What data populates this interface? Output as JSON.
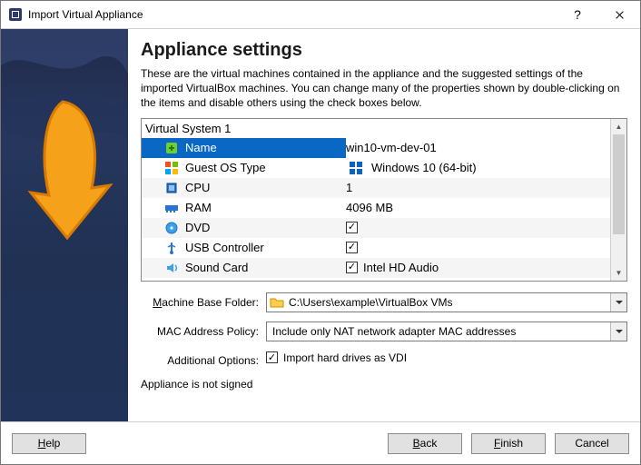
{
  "window": {
    "title": "Import Virtual Appliance"
  },
  "heading": "Appliance settings",
  "intro": "These are the virtual machines contained in the appliance and the suggested settings of the imported VirtualBox machines. You can change many of the properties shown by double-clicking on the items and disable others using the check boxes below.",
  "table": {
    "system_label": "Virtual System 1",
    "rows": {
      "name": {
        "label": "Name",
        "value": "win10-vm-dev-01"
      },
      "os": {
        "label": "Guest OS Type",
        "value": "Windows 10 (64-bit)"
      },
      "cpu": {
        "label": "CPU",
        "value": "1"
      },
      "ram": {
        "label": "RAM",
        "value": "4096 MB"
      },
      "dvd": {
        "label": "DVD",
        "checked": true
      },
      "usb": {
        "label": "USB Controller",
        "checked": true
      },
      "sound": {
        "label": "Sound Card",
        "checked": true,
        "value": "Intel HD Audio"
      }
    }
  },
  "form": {
    "base_folder_label": "achine Base Folder:",
    "base_folder_prefix": "M",
    "base_folder_value": "C:\\Users\\example\\VirtualBox VMs",
    "mac_label": "MAC Address Policy:",
    "mac_value": "Include only NAT network adapter MAC addresses",
    "options_label": "Additional Options:",
    "vdi_label": "Import hard drives as VDI",
    "vdi_checked": true,
    "unsigned": "Appliance is not signed"
  },
  "footer": {
    "help": "elp",
    "help_prefix": "H",
    "back": "ack",
    "back_prefix": "B",
    "finish": "inish",
    "finish_prefix": "F",
    "cancel": "Cancel"
  }
}
